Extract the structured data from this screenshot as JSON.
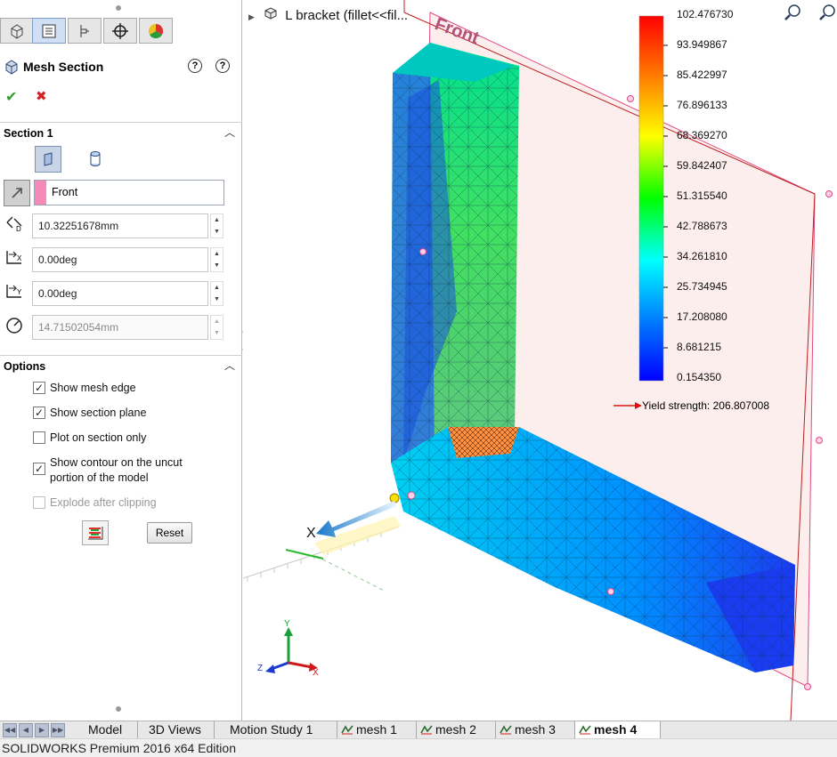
{
  "property_manager": {
    "tabs": [
      "feature-manager-tab",
      "property-manager-tab",
      "configuration-manager-tab",
      "dimxpert-tab",
      "display-manager-tab"
    ],
    "title": "Mesh Section",
    "help_icons": [
      "whats-wrong-icon",
      "help-icon"
    ],
    "ok_label": "✔",
    "cancel_label": "✖",
    "section1": {
      "header": "Section 1",
      "reference_plane": "Front",
      "offset": "10.32251678mm",
      "angle_x": "0.00deg",
      "angle_y": "0.00deg",
      "radius": "14.71502054mm"
    },
    "options": {
      "header": "Options",
      "items": [
        {
          "label": "Show mesh edge",
          "checked": true,
          "enabled": true
        },
        {
          "label": "Show section plane",
          "checked": true,
          "enabled": true
        },
        {
          "label": "Plot on section only",
          "checked": false,
          "enabled": true
        },
        {
          "label": "Show contour on the uncut",
          "label2": "portion of the model",
          "checked": true,
          "enabled": true
        },
        {
          "label": "Explode after clipping",
          "checked": false,
          "enabled": false
        }
      ],
      "reset_label": "Reset"
    }
  },
  "graphics": {
    "tree_label": "L bracket  (fillet<<fil...",
    "plane_label": "Front",
    "x_axis_label": "X",
    "triad": {
      "x": "X",
      "y": "Y",
      "z": "Z"
    },
    "legend": {
      "values": [
        "102.476730",
        "93.949867",
        "85.422997",
        "76.896133",
        "68.369270",
        "59.842407",
        "51.315540",
        "42.788673",
        "34.261810",
        "25.734945",
        "17.208080",
        "8.681215",
        "0.154350"
      ],
      "yield_label": "Yield strength: 206.807008",
      "colors": [
        "#ff0000",
        "#ff8000",
        "#ffff00",
        "#00ff00",
        "#00ffff",
        "#0080ff",
        "#0000ff"
      ]
    }
  },
  "bottom_tabs": [
    "Model",
    "3D Views",
    "Motion Study 1",
    "mesh 1",
    "mesh 2",
    "mesh 3",
    "mesh 4"
  ],
  "active_tab": "mesh 4",
  "status_bar": "SOLIDWORKS Premium 2016 x64 Edition"
}
